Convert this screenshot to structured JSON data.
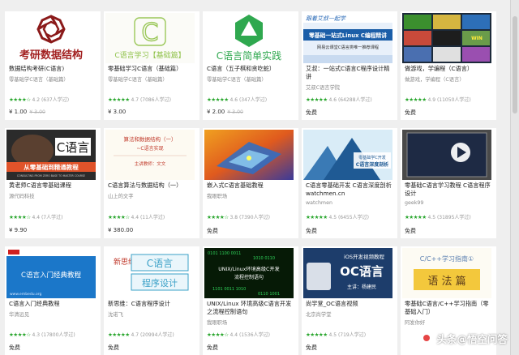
{
  "courses": [
    {
      "title": "数据结构考研(C语言)",
      "author": "零基础学C语言（基础篇）",
      "rating": "4.2",
      "learners": "(637人学过)",
      "price": "¥ 1.00",
      "old_price": "¥ 3.00",
      "thumb_text": "考研数据结构"
    },
    {
      "title": "零基础学习C语言（基础篇）",
      "author": "零基础学C语言（基础篇）",
      "rating": "4.7",
      "learners": "(7086人学过)",
      "price": "¥ 3.00",
      "old_price": "",
      "thumb_text": "C语言学习【基础篇】"
    },
    {
      "title": "C语言（五子棋和贪吃蛇）",
      "author": "零基础学C语言（基础篇）",
      "rating": "4.6",
      "learners": "(347人学过)",
      "price": "¥ 2.00",
      "old_price": "¥ 3.00",
      "thumb_text": "C语言简单实践"
    },
    {
      "title": "艾叔：一站式C语言C程序设计精讲",
      "author": "艾叔C语言学院",
      "rating": "4.6",
      "learners": "(64288人学过)",
      "price": "免费",
      "old_price": "",
      "thumb_text": "零基础一站式Linux C编程精讲",
      "thumb_header": "跟着艾叔一起学",
      "thumb_sub": "网易云课堂C语言类唯一推荐课程"
    },
    {
      "title": "做游戏，学编程（C语言）",
      "author": "做游戏，学编程（C语言）",
      "rating": "4.9",
      "learners": "(11050人学过)",
      "price": "免费",
      "old_price": "",
      "thumb_text": "WIN"
    },
    {
      "title": "黄老师C语言零基础课程",
      "author": "源代码科技",
      "rating": "4.4",
      "learners": "(7人学过)",
      "price": "¥ 9.90",
      "old_price": "",
      "thumb_text": "C语言",
      "thumb_banner": "从零基础到精通教程",
      "thumb_banner_en": "CONSULTING FROM ZERO BASE TO MASTER COURSE"
    },
    {
      "title": "C语言算法与数据结构（一）",
      "author": "山上的文字",
      "rating": "4.4",
      "learners": "(11人学过)",
      "price": "¥ 380.00",
      "old_price": "",
      "thumb_text": "算法和数据结构（一）",
      "thumb_sub": "~C语言实现",
      "thumb_sub2": "主讲教师：文文"
    },
    {
      "title": "嵌入式C语言基础教程",
      "author": "我眼职场",
      "rating": "3.8",
      "learners": "(7390人学过)",
      "price": "免费",
      "old_price": ""
    },
    {
      "title": "C语言零基础开发 C语言深度剖析 watchmen.cn",
      "author": "watchmen",
      "rating": "4.5",
      "learners": "(6455人学过)",
      "price": "免费",
      "old_price": "",
      "thumb_text": "C语言深度剖析",
      "thumb_sub": "零基础学C开发"
    },
    {
      "title": "零基础C语言学习教程 C语言程序设计",
      "author": "geek99",
      "rating": "4.5",
      "learners": "(31895人学过)",
      "price": "免费",
      "old_price": ""
    },
    {
      "title": "C语言入门经典教程",
      "author": "华清远见",
      "rating": "4.3",
      "learners": "(17800人学过)",
      "price": "免费",
      "old_price": "",
      "thumb_text": "C语言入门经典教程",
      "thumb_url": "www.embedu.org"
    },
    {
      "title": "新思维：C语言程序设计",
      "author": "沈诺飞",
      "rating": "4.7",
      "learners": "(20994人学过)",
      "price": "免费",
      "old_price": "",
      "thumb_text": "C语言",
      "thumb_sub": "程序设计",
      "thumb_side": "新思维"
    },
    {
      "title": "UNIX/Linux 环境高级C语言开发之流程控制语句",
      "author": "我眼职场",
      "rating": "4.4",
      "learners": "(1536人学过)",
      "price": "免费",
      "old_price": "",
      "thumb_text": "UNIX/Linux环境高级C开发",
      "thumb_sub": "流程控制语句"
    },
    {
      "title": "尚学堂_OC语言视频",
      "author": "北京尚学堂",
      "rating": "4.5",
      "learners": "(719人学过)",
      "price": "免费",
      "old_price": "",
      "thumb_text": "OC语言",
      "thumb_header": "iOS开发视频教程",
      "thumb_sub": "主讲：杨建民"
    },
    {
      "title": "零基础C语言/C++学习指南（零基础入门）",
      "author": "阿发你好",
      "rating": "",
      "learners": "",
      "price": "",
      "old_price": "",
      "thumb_text": "C/C++学习指南①",
      "thumb_sub": "语 法 篇"
    }
  ],
  "watermark": {
    "text": "头条@悟空问答"
  },
  "colors": {
    "star": "#27a52b"
  }
}
